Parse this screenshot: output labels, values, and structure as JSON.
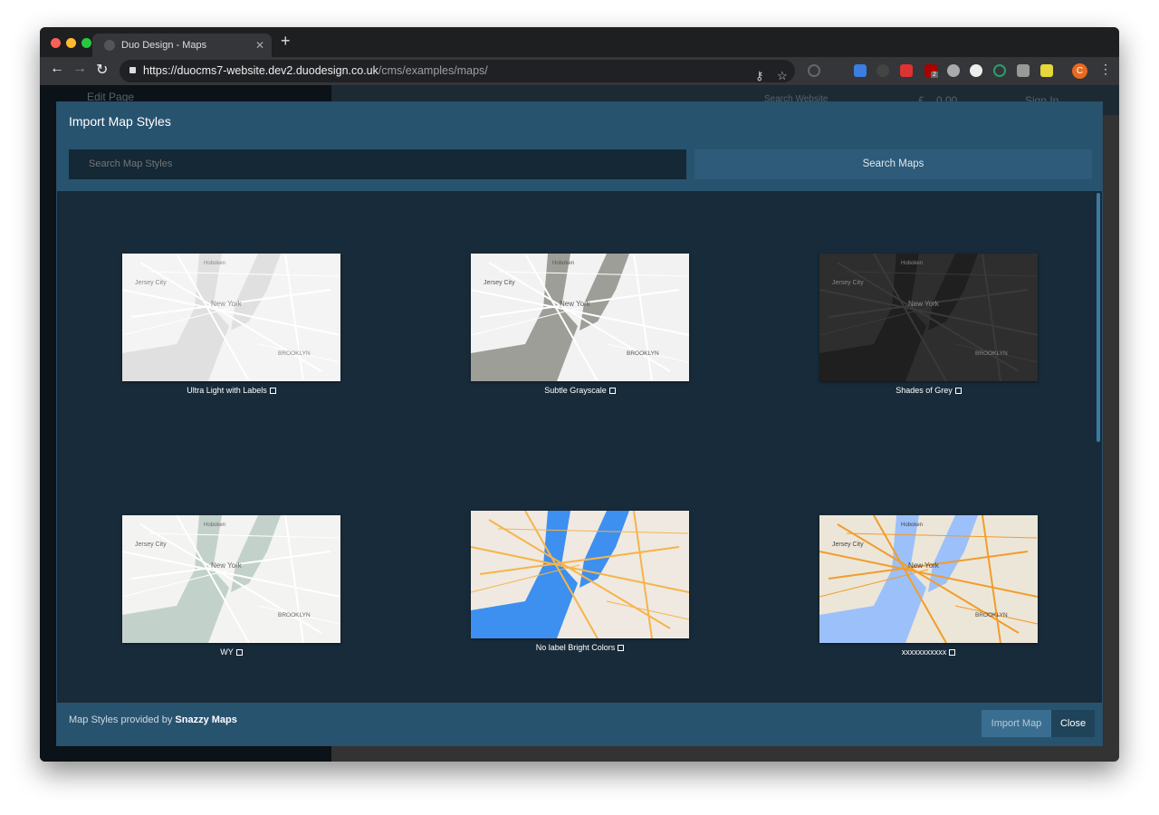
{
  "browser": {
    "tab_title": "Duo Design - Maps",
    "url_host": "https://duocms7-website.dev2.duodesign.co.uk",
    "url_path": "/cms/examples/maps/",
    "profile_initial": "C",
    "extension_badge": "2"
  },
  "background_page": {
    "edit_page": "Edit Page",
    "search_placeholder": "Search Website",
    "currency": "£",
    "basket_total": "0.00",
    "sign_in": "Sign In"
  },
  "modal": {
    "title": "Import Map Styles",
    "search_placeholder": "Search Map Styles",
    "search_button": "Search Maps",
    "footer_prefix": "Map Styles provided by ",
    "footer_brand": "Snazzy Maps",
    "import_button": "Import Map",
    "close_button": "Close"
  },
  "map_labels": {
    "a": "Hoboken",
    "b": "Jersey City",
    "c": "New York",
    "d": "BROOKLYN"
  },
  "styles": [
    {
      "name": "Ultra Light with Labels",
      "land": "#f4f4f4",
      "water": "#e0e0e0",
      "road": "#ffffff",
      "text": "#888888"
    },
    {
      "name": "Subtle Grayscale",
      "land": "#f2f2f2",
      "water": "#9e9e98",
      "road": "#ffffff",
      "text": "#555555"
    },
    {
      "name": "Shades of Grey",
      "land": "#2e2e2e",
      "water": "#1f1f1f",
      "road": "#3a3a3a",
      "text": "#8a8a8a"
    },
    {
      "name": "WY",
      "land": "#f3f3f1",
      "water": "#c3d1cb",
      "road": "#ffffff",
      "text": "#666666"
    },
    {
      "name": "No label Bright Colors",
      "land": "#efe9e2",
      "water": "#3d8ff0",
      "road": "#f6b44a",
      "text": ""
    },
    {
      "name": "xxxxxxxxxxx",
      "land": "#ece6d8",
      "water": "#9cc0f9",
      "road": "#f29c2c",
      "text": "#444444"
    }
  ]
}
